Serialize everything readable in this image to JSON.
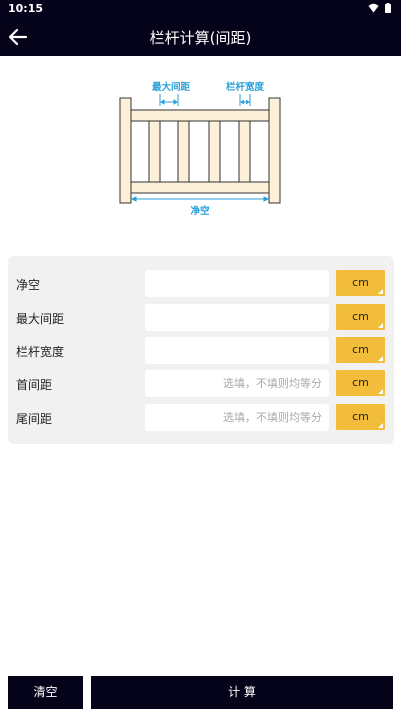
{
  "status_bar": {
    "time": "10:15",
    "icons": [
      "wifi-icon",
      "battery-icon"
    ]
  },
  "app_bar": {
    "title": "栏杆计算(间距)",
    "back_icon": "back-arrow-icon"
  },
  "diagram": {
    "label_max_spacing": "最大间距",
    "label_rail_width": "栏杆宽度",
    "label_clear": "净空"
  },
  "form": {
    "rows": [
      {
        "label": "净空",
        "placeholder": "",
        "unit": "cm"
      },
      {
        "label": "最大间距",
        "placeholder": "",
        "unit": "cm"
      },
      {
        "label": "栏杆宽度",
        "placeholder": "",
        "unit": "cm"
      },
      {
        "label": "首间距",
        "placeholder": "选填，不填则均等分",
        "unit": "cm"
      },
      {
        "label": "尾间距",
        "placeholder": "选填，不填则均等分",
        "unit": "cm"
      }
    ]
  },
  "buttons": {
    "clear": "清空",
    "calculate": "计 算"
  },
  "colors": {
    "dark": "#05031a",
    "accent": "#f2bd3b",
    "card": "#f1f1f1",
    "diagram_blue": "#2aa0d8",
    "wood": "#fdf0d8"
  }
}
